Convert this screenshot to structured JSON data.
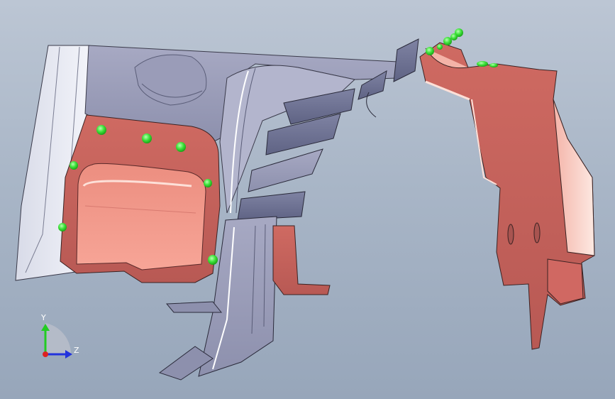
{
  "viewport": {
    "background_top": "#bcc6d4",
    "background_bottom": "#97a6ba"
  },
  "triad": {
    "y_label": "Y",
    "z_label": "Z",
    "y_color": "#22cc22",
    "z_color": "#2233dd",
    "x_color": "#dd2222"
  },
  "model": {
    "die_face_color": "#8a8fb0",
    "part_color": "#e8887a",
    "pin_color": "#33dd33"
  }
}
